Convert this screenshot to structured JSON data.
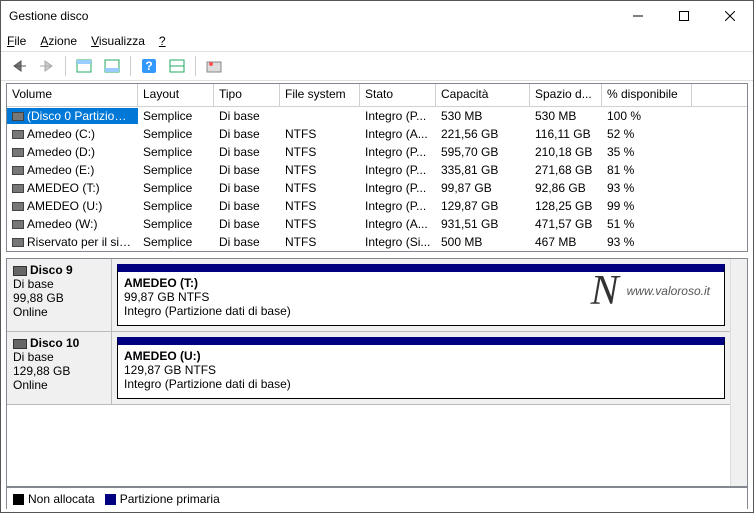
{
  "window": {
    "title": "Gestione disco"
  },
  "menu": {
    "file": "File",
    "file_u": "F",
    "action": "Azione",
    "action_u": "A",
    "view": "Visualizza",
    "view_u": "V",
    "help": "?",
    "help_u": "?"
  },
  "columns": [
    "Volume",
    "Layout",
    "Tipo",
    "File system",
    "Stato",
    "Capacità",
    "Spazio d...",
    "% disponibile"
  ],
  "rows": [
    {
      "vol": "(Disco 0 Partizione...",
      "layout": "Semplice",
      "tipo": "Di base",
      "fs": "",
      "stato": "Integro (P...",
      "cap": "530 MB",
      "free": "530 MB",
      "pct": "100 %",
      "sel": true
    },
    {
      "vol": "Amedeo (C:)",
      "layout": "Semplice",
      "tipo": "Di base",
      "fs": "NTFS",
      "stato": "Integro (A...",
      "cap": "221,56 GB",
      "free": "116,11 GB",
      "pct": "52 %"
    },
    {
      "vol": "Amedeo (D:)",
      "layout": "Semplice",
      "tipo": "Di base",
      "fs": "NTFS",
      "stato": "Integro (P...",
      "cap": "595,70 GB",
      "free": "210,18 GB",
      "pct": "35 %"
    },
    {
      "vol": "Amedeo (E:)",
      "layout": "Semplice",
      "tipo": "Di base",
      "fs": "NTFS",
      "stato": "Integro (P...",
      "cap": "335,81 GB",
      "free": "271,68 GB",
      "pct": "81 %"
    },
    {
      "vol": "AMEDEO (T:)",
      "layout": "Semplice",
      "tipo": "Di base",
      "fs": "NTFS",
      "stato": "Integro (P...",
      "cap": "99,87 GB",
      "free": "92,86 GB",
      "pct": "93 %"
    },
    {
      "vol": "AMEDEO (U:)",
      "layout": "Semplice",
      "tipo": "Di base",
      "fs": "NTFS",
      "stato": "Integro (P...",
      "cap": "129,87 GB",
      "free": "128,25 GB",
      "pct": "99 %"
    },
    {
      "vol": "Amedeo (W:)",
      "layout": "Semplice",
      "tipo": "Di base",
      "fs": "NTFS",
      "stato": "Integro (A...",
      "cap": "931,51 GB",
      "free": "471,57 GB",
      "pct": "51 %"
    },
    {
      "vol": "Riservato per il sist...",
      "layout": "Semplice",
      "tipo": "Di base",
      "fs": "NTFS",
      "stato": "Integro (Si...",
      "cap": "500 MB",
      "free": "467 MB",
      "pct": "93 %"
    }
  ],
  "disks": [
    {
      "name": "Disco 9",
      "type": "Di base",
      "size": "99,88 GB",
      "status": "Online",
      "part_name": "AMEDEO  (T:)",
      "part_size": "99,87 GB NTFS",
      "part_status": "Integro (Partizione dati di base)"
    },
    {
      "name": "Disco 10",
      "type": "Di base",
      "size": "129,88 GB",
      "status": "Online",
      "part_name": "AMEDEO  (U:)",
      "part_size": "129,87 GB NTFS",
      "part_status": "Integro (Partizione dati di base)"
    }
  ],
  "legend": {
    "unalloc": "Non allocata",
    "primary": "Partizione primaria"
  },
  "watermark": {
    "text": "www.valoroso.it"
  }
}
